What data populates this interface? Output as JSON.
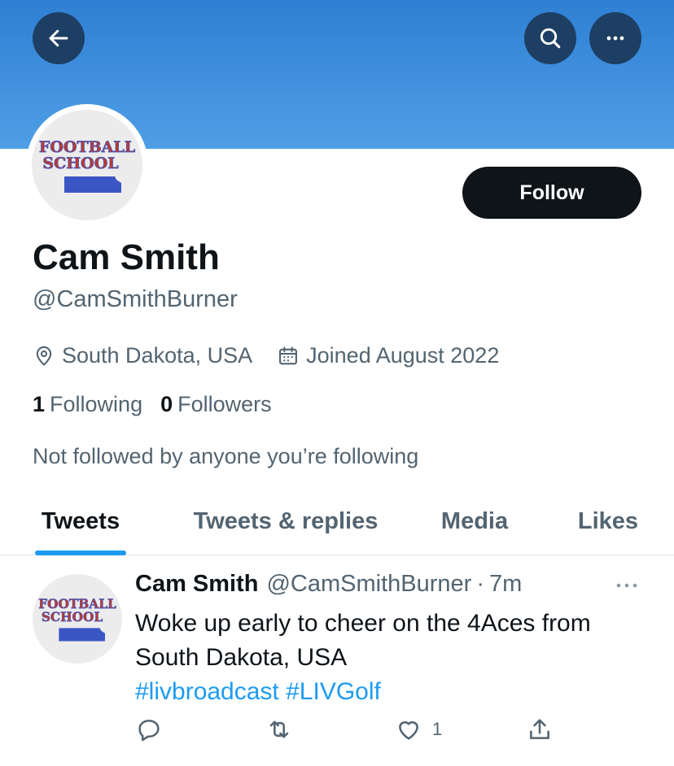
{
  "header": {
    "back_icon": "arrow-left-icon",
    "search_icon": "search-icon",
    "more_icon": "more-horizontal-icon",
    "banner_color": "#4a9ae4",
    "button_color": "#1d3f63"
  },
  "profile": {
    "avatar_text_line1": "FOOTBALL",
    "avatar_text_line2": "SCHOOL",
    "follow_label": "Follow",
    "display_name": "Cam Smith",
    "handle": "@CamSmithBurner",
    "location": "South Dakota, USA",
    "joined": "Joined August 2022",
    "following_count": "1",
    "following_label": "Following",
    "followers_count": "0",
    "followers_label": "Followers",
    "not_followed_text": "Not followed by anyone you’re following"
  },
  "tabs": [
    {
      "label": "Tweets",
      "active": true
    },
    {
      "label": "Tweets & replies",
      "active": false
    },
    {
      "label": "Media",
      "active": false
    },
    {
      "label": "Likes",
      "active": false
    }
  ],
  "tweet": {
    "name": "Cam Smith",
    "handle": "@CamSmithBurner",
    "separator": "·",
    "time": "7m",
    "text_line1": "Woke up early to cheer on the 4Aces from",
    "text_line2": "South Dakota, USA",
    "hashtags": [
      "#livbroadcast",
      "#LIVGolf"
    ],
    "like_count": "1",
    "action_icons": [
      "reply-icon",
      "retweet-icon",
      "like-icon",
      "share-icon"
    ]
  },
  "colors": {
    "accent": "#1d9bf0",
    "text_primary": "#0f1419",
    "text_secondary": "#536471",
    "logo_red": "#c0392b",
    "logo_blue": "#3b56c4"
  }
}
